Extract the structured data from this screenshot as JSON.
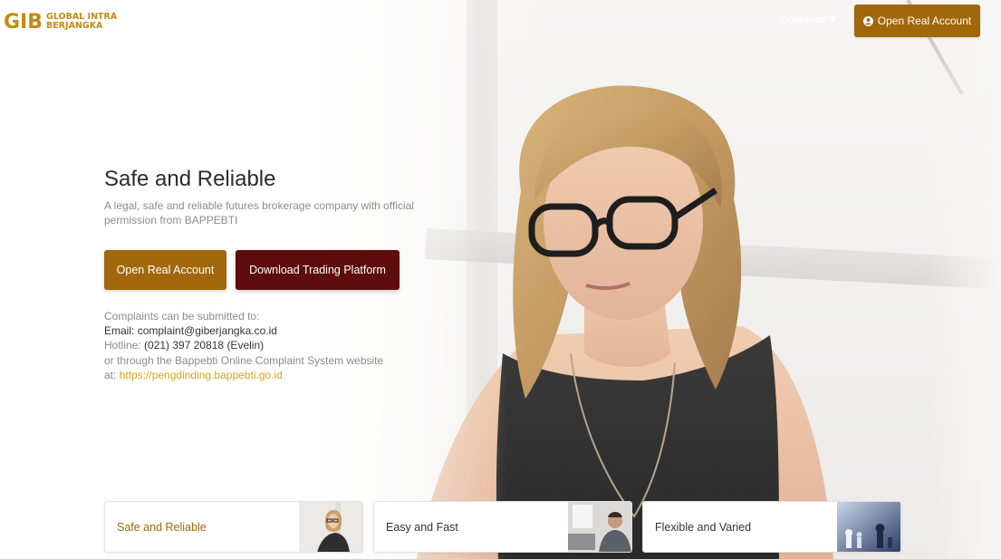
{
  "header": {
    "logo": {
      "mark": "GIB",
      "line1": "GLOBAL INTRA",
      "line2": "BERJANGKA"
    },
    "nav_download": "Download",
    "open_account_label": "Open Real Account"
  },
  "hero": {
    "title": "Safe and Reliable",
    "description": "A legal, safe and reliable futures brokerage company with official permission from BAPPEBTI",
    "primary_button": "Open Real Account",
    "secondary_button": "Download Trading Platform"
  },
  "complaints": {
    "intro": "Complaints can be submitted to:",
    "email_label": "Email:",
    "email": "complaint@giberjangka.co.id",
    "hotline_label": "Hotline:",
    "hotline": "(021) 397 20818 (Evelin)",
    "bappebti_text": "or through the Bappebti Online Complaint System website",
    "at_label": "at:",
    "url": "https://pengdinding.bappebti.go.id"
  },
  "cards": [
    {
      "label": "Safe and Reliable",
      "active": true
    },
    {
      "label": "Easy and Fast",
      "active": false
    },
    {
      "label": "Flexible and Varied",
      "active": false
    }
  ],
  "colors": {
    "brand_gold": "#a0670b",
    "brand_dark_red": "#5e0c0c",
    "link_gold": "#d6a41a",
    "logo_gold": "#c28b12"
  },
  "icons": {
    "user": "user-circle-icon",
    "dropdown": "chevron-down-icon"
  }
}
